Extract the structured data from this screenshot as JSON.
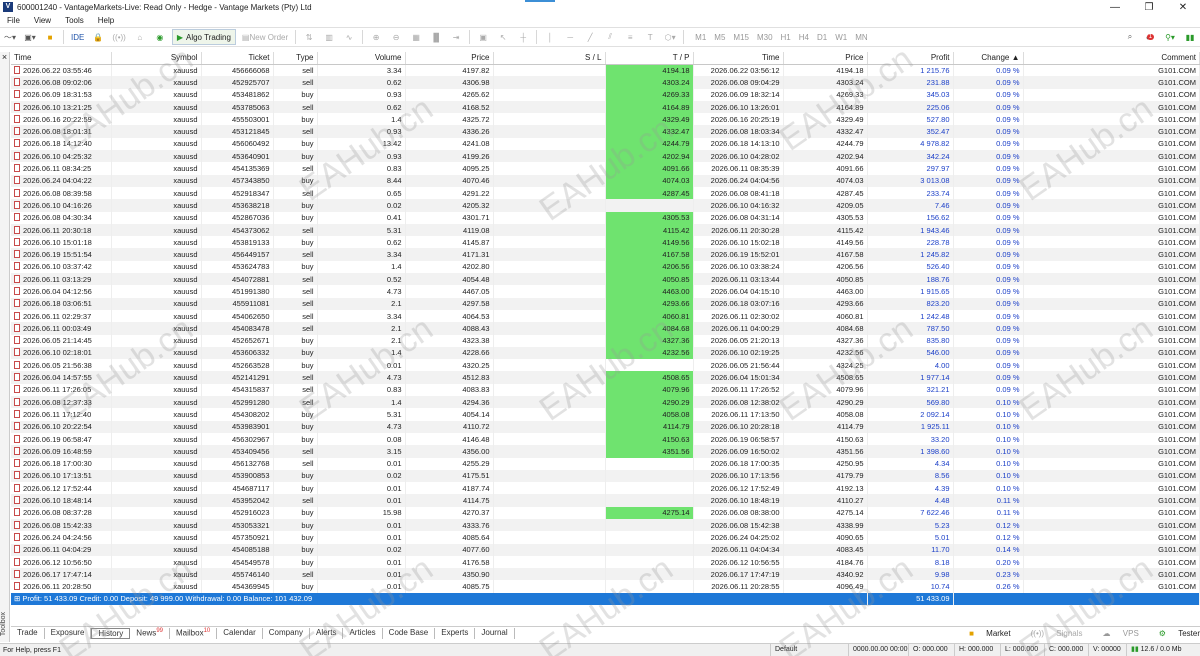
{
  "window": {
    "title": "600001240 - VantageMarkets-Live: Read Only - Hedge - Vantage Markets (Pty) Ltd",
    "app_icon": "V",
    "controls": [
      "—",
      "❐",
      "✕"
    ]
  },
  "menu": [
    "File",
    "View",
    "Tools",
    "Help"
  ],
  "toolbar": {
    "ide_label": "IDE",
    "algo_label": "Algo Trading",
    "new_order_label": "New Order",
    "timeframes": [
      "M1",
      "M5",
      "M15",
      "M30",
      "H1",
      "H4",
      "D1",
      "W1",
      "MN"
    ],
    "notif_count": "1"
  },
  "sidestrip": {
    "close": "×",
    "label": "Toolbox"
  },
  "columns": [
    "Time",
    "Symbol",
    "Ticket",
    "Type",
    "Volume",
    "Price",
    "S / L",
    "T / P",
    "Time",
    "Price",
    "Profit",
    "Change",
    "Comment"
  ],
  "sort_indicator": "▲",
  "rows": [
    {
      "t": "2026.06.22 03:55:46",
      "s": "xauusd",
      "k": "456666068",
      "ty": "sell",
      "v": "3.34",
      "p": "4197.82",
      "sl": "",
      "tp": "4194.18",
      "t2": "2026.06.22 03:56:12",
      "p2": "4194.18",
      "pr": "1 215.76",
      "ch": "0.09 %",
      "c": "G101.COM"
    },
    {
      "t": "2026.06.08 09:02:06",
      "s": "xauusd",
      "k": "452925707",
      "ty": "sell",
      "v": "0.62",
      "p": "4306.98",
      "sl": "",
      "tp": "4303.24",
      "t2": "2026.06.08 09:04:29",
      "p2": "4303.24",
      "pr": "231.88",
      "ch": "0.09 %",
      "c": "G101.COM"
    },
    {
      "t": "2026.06.09 18:31:53",
      "s": "xauusd",
      "k": "453481862",
      "ty": "buy",
      "v": "0.93",
      "p": "4265.62",
      "sl": "",
      "tp": "4269.33",
      "t2": "2026.06.09 18:32:14",
      "p2": "4269.33",
      "pr": "345.03",
      "ch": "0.09 %",
      "c": "G101.COM"
    },
    {
      "t": "2026.06.10 13:21:25",
      "s": "xauusd",
      "k": "453785063",
      "ty": "sell",
      "v": "0.62",
      "p": "4168.52",
      "sl": "",
      "tp": "4164.89",
      "t2": "2026.06.10 13:26:01",
      "p2": "4164.89",
      "pr": "225.06",
      "ch": "0.09 %",
      "c": "G101.COM"
    },
    {
      "t": "2026.06.16 20:22:59",
      "s": "xauusd",
      "k": "455503001",
      "ty": "buy",
      "v": "1.4",
      "p": "4325.72",
      "sl": "",
      "tp": "4329.49",
      "t2": "2026.06.16 20:25:19",
      "p2": "4329.49",
      "pr": "527.80",
      "ch": "0.09 %",
      "c": "G101.COM"
    },
    {
      "t": "2026.06.08 18:01:31",
      "s": "xauusd",
      "k": "453121845",
      "ty": "sell",
      "v": "0.93",
      "p": "4336.26",
      "sl": "",
      "tp": "4332.47",
      "t2": "2026.06.08 18:03:34",
      "p2": "4332.47",
      "pr": "352.47",
      "ch": "0.09 %",
      "c": "G101.COM"
    },
    {
      "t": "2026.06.18 14:12:40",
      "s": "xauusd",
      "k": "456060492",
      "ty": "buy",
      "v": "13.42",
      "p": "4241.08",
      "sl": "",
      "tp": "4244.79",
      "t2": "2026.06.18 14:13:10",
      "p2": "4244.79",
      "pr": "4 978.82",
      "ch": "0.09 %",
      "c": "G101.COM"
    },
    {
      "t": "2026.06.10 04:25:32",
      "s": "xauusd",
      "k": "453640901",
      "ty": "buy",
      "v": "0.93",
      "p": "4199.26",
      "sl": "",
      "tp": "4202.94",
      "t2": "2026.06.10 04:28:02",
      "p2": "4202.94",
      "pr": "342.24",
      "ch": "0.09 %",
      "c": "G101.COM"
    },
    {
      "t": "2026.06.11 08:34:25",
      "s": "xauusd",
      "k": "454135369",
      "ty": "sell",
      "v": "0.83",
      "p": "4095.25",
      "sl": "",
      "tp": "4091.66",
      "t2": "2026.06.11 08:35:39",
      "p2": "4091.66",
      "pr": "297.97",
      "ch": "0.09 %",
      "c": "G101.COM"
    },
    {
      "t": "2026.06.24 04:04:22",
      "s": "xauusd",
      "k": "457343850",
      "ty": "buy",
      "v": "8.44",
      "p": "4070.46",
      "sl": "",
      "tp": "4074.03",
      "t2": "2026.06.24 04:04:56",
      "p2": "4074.03",
      "pr": "3 013.08",
      "ch": "0.09 %",
      "c": "G101.COM"
    },
    {
      "t": "2026.06.08 08:39:58",
      "s": "xauusd",
      "k": "452918347",
      "ty": "sell",
      "v": "0.65",
      "p": "4291.22",
      "sl": "",
      "tp": "4287.45",
      "t2": "2026.06.08 08:41:18",
      "p2": "4287.45",
      "pr": "233.74",
      "ch": "0.09 %",
      "c": "G101.COM"
    },
    {
      "t": "2026.06.10 04:16:26",
      "s": "xauusd",
      "k": "453638218",
      "ty": "buy",
      "v": "0.02",
      "p": "4205.32",
      "sl": "",
      "tp": "",
      "t2": "2026.06.10 04:16:32",
      "p2": "4209.05",
      "pr": "7.46",
      "ch": "0.09 %",
      "c": "G101.COM"
    },
    {
      "t": "2026.06.08 04:30:34",
      "s": "xauusd",
      "k": "452867036",
      "ty": "buy",
      "v": "0.41",
      "p": "4301.71",
      "sl": "",
      "tp": "4305.53",
      "t2": "2026.06.08 04:31:14",
      "p2": "4305.53",
      "pr": "156.62",
      "ch": "0.09 %",
      "c": "G101.COM"
    },
    {
      "t": "2026.06.11 20:30:18",
      "s": "xauusd",
      "k": "454373062",
      "ty": "sell",
      "v": "5.31",
      "p": "4119.08",
      "sl": "",
      "tp": "4115.42",
      "t2": "2026.06.11 20:30:28",
      "p2": "4115.42",
      "pr": "1 943.46",
      "ch": "0.09 %",
      "c": "G101.COM"
    },
    {
      "t": "2026.06.10 15:01:18",
      "s": "xauusd",
      "k": "453819133",
      "ty": "buy",
      "v": "0.62",
      "p": "4145.87",
      "sl": "",
      "tp": "4149.56",
      "t2": "2026.06.10 15:02:18",
      "p2": "4149.56",
      "pr": "228.78",
      "ch": "0.09 %",
      "c": "G101.COM"
    },
    {
      "t": "2026.06.19 15:51:54",
      "s": "xauusd",
      "k": "456449157",
      "ty": "sell",
      "v": "3.34",
      "p": "4171.31",
      "sl": "",
      "tp": "4167.58",
      "t2": "2026.06.19 15:52:01",
      "p2": "4167.58",
      "pr": "1 245.82",
      "ch": "0.09 %",
      "c": "G101.COM"
    },
    {
      "t": "2026.06.10 03:37:42",
      "s": "xauusd",
      "k": "453624783",
      "ty": "buy",
      "v": "1.4",
      "p": "4202.80",
      "sl": "",
      "tp": "4206.56",
      "t2": "2026.06.10 03:38:24",
      "p2": "4206.56",
      "pr": "526.40",
      "ch": "0.09 %",
      "c": "G101.COM"
    },
    {
      "t": "2026.06.11 03:13:29",
      "s": "xauusd",
      "k": "454072881",
      "ty": "sell",
      "v": "0.52",
      "p": "4054.48",
      "sl": "",
      "tp": "4050.85",
      "t2": "2026.06.11 03:13:44",
      "p2": "4050.85",
      "pr": "188.76",
      "ch": "0.09 %",
      "c": "G101.COM"
    },
    {
      "t": "2026.06.04 04:12:56",
      "s": "xauusd",
      "k": "451991380",
      "ty": "sell",
      "v": "4.73",
      "p": "4467.05",
      "sl": "",
      "tp": "4463.00",
      "t2": "2026.06.04 04:15:10",
      "p2": "4463.00",
      "pr": "1 915.65",
      "ch": "0.09 %",
      "c": "G101.COM"
    },
    {
      "t": "2026.06.18 03:06:51",
      "s": "xauusd",
      "k": "455911081",
      "ty": "sell",
      "v": "2.1",
      "p": "4297.58",
      "sl": "",
      "tp": "4293.66",
      "t2": "2026.06.18 03:07:16",
      "p2": "4293.66",
      "pr": "823.20",
      "ch": "0.09 %",
      "c": "G101.COM"
    },
    {
      "t": "2026.06.11 02:29:37",
      "s": "xauusd",
      "k": "454062650",
      "ty": "sell",
      "v": "3.34",
      "p": "4064.53",
      "sl": "",
      "tp": "4060.81",
      "t2": "2026.06.11 02:30:02",
      "p2": "4060.81",
      "pr": "1 242.48",
      "ch": "0.09 %",
      "c": "G101.COM"
    },
    {
      "t": "2026.06.11 00:03:49",
      "s": "xauusd",
      "k": "454083478",
      "ty": "sell",
      "v": "2.1",
      "p": "4088.43",
      "sl": "",
      "tp": "4084.68",
      "t2": "2026.06.11 04:00:29",
      "p2": "4084.68",
      "pr": "787.50",
      "ch": "0.09 %",
      "c": "G101.COM"
    },
    {
      "t": "2026.06.05 21:14:45",
      "s": "xauusd",
      "k": "452652671",
      "ty": "buy",
      "v": "2.1",
      "p": "4323.38",
      "sl": "",
      "tp": "4327.36",
      "t2": "2026.06.05 21:20:13",
      "p2": "4327.36",
      "pr": "835.80",
      "ch": "0.09 %",
      "c": "G101.COM"
    },
    {
      "t": "2026.06.10 02:18:01",
      "s": "xauusd",
      "k": "453606332",
      "ty": "buy",
      "v": "1.4",
      "p": "4228.66",
      "sl": "",
      "tp": "4232.56",
      "t2": "2026.06.10 02:19:25",
      "p2": "4232.56",
      "pr": "546.00",
      "ch": "0.09 %",
      "c": "G101.COM"
    },
    {
      "t": "2026.06.05 21:56:38",
      "s": "xauusd",
      "k": "452663528",
      "ty": "buy",
      "v": "0.01",
      "p": "4320.25",
      "sl": "",
      "tp": "",
      "t2": "2026.06.05 21:56:44",
      "p2": "4324.25",
      "pr": "4.00",
      "ch": "0.09 %",
      "c": "G101.COM"
    },
    {
      "t": "2026.06.04 14:57:55",
      "s": "xauusd",
      "k": "452141291",
      "ty": "sell",
      "v": "4.73",
      "p": "4512.83",
      "sl": "",
      "tp": "4508.65",
      "t2": "2026.06.04 15:01:34",
      "p2": "4508.65",
      "pr": "1 977.14",
      "ch": "0.09 %",
      "c": "G101.COM"
    },
    {
      "t": "2026.06.11 17:26:05",
      "s": "xauusd",
      "k": "454315837",
      "ty": "sell",
      "v": "0.83",
      "p": "4083.83",
      "sl": "",
      "tp": "4079.96",
      "t2": "2026.06.11 17:26:52",
      "p2": "4079.96",
      "pr": "321.21",
      "ch": "0.09 %",
      "c": "G101.COM"
    },
    {
      "t": "2026.06.08 12:37:33",
      "s": "xauusd",
      "k": "452991280",
      "ty": "sell",
      "v": "1.4",
      "p": "4294.36",
      "sl": "",
      "tp": "4290.29",
      "t2": "2026.06.08 12:38:02",
      "p2": "4290.29",
      "pr": "569.80",
      "ch": "0.10 %",
      "c": "G101.COM"
    },
    {
      "t": "2026.06.11 17:12:40",
      "s": "xauusd",
      "k": "454308202",
      "ty": "buy",
      "v": "5.31",
      "p": "4054.14",
      "sl": "",
      "tp": "4058.08",
      "t2": "2026.06.11 17:13:50",
      "p2": "4058.08",
      "pr": "2 092.14",
      "ch": "0.10 %",
      "c": "G101.COM"
    },
    {
      "t": "2026.06.10 20:22:54",
      "s": "xauusd",
      "k": "453983901",
      "ty": "buy",
      "v": "4.73",
      "p": "4110.72",
      "sl": "",
      "tp": "4114.79",
      "t2": "2026.06.10 20:28:18",
      "p2": "4114.79",
      "pr": "1 925.11",
      "ch": "0.10 %",
      "c": "G101.COM"
    },
    {
      "t": "2026.06.19 06:58:47",
      "s": "xauusd",
      "k": "456302967",
      "ty": "buy",
      "v": "0.08",
      "p": "4146.48",
      "sl": "",
      "tp": "4150.63",
      "t2": "2026.06.19 06:58:57",
      "p2": "4150.63",
      "pr": "33.20",
      "ch": "0.10 %",
      "c": "G101.COM"
    },
    {
      "t": "2026.06.09 16:48:59",
      "s": "xauusd",
      "k": "453409456",
      "ty": "sell",
      "v": "3.15",
      "p": "4356.00",
      "sl": "",
      "tp": "4351.56",
      "t2": "2026.06.09 16:50:02",
      "p2": "4351.56",
      "pr": "1 398.60",
      "ch": "0.10 %",
      "c": "G101.COM"
    },
    {
      "t": "2026.06.18 17:00:30",
      "s": "xauusd",
      "k": "456132768",
      "ty": "sell",
      "v": "0.01",
      "p": "4255.29",
      "sl": "",
      "tp": "",
      "t2": "2026.06.18 17:00:35",
      "p2": "4250.95",
      "pr": "4.34",
      "ch": "0.10 %",
      "c": "G101.COM"
    },
    {
      "t": "2026.06.10 17:13:51",
      "s": "xauusd",
      "k": "453900853",
      "ty": "buy",
      "v": "0.02",
      "p": "4175.51",
      "sl": "",
      "tp": "",
      "t2": "2026.06.10 17:13:56",
      "p2": "4179.79",
      "pr": "8.56",
      "ch": "0.10 %",
      "c": "G101.COM"
    },
    {
      "t": "2026.06.12 17:52:44",
      "s": "xauusd",
      "k": "454687117",
      "ty": "buy",
      "v": "0.01",
      "p": "4187.74",
      "sl": "",
      "tp": "",
      "t2": "2026.06.12 17:52:49",
      "p2": "4192.13",
      "pr": "4.39",
      "ch": "0.10 %",
      "c": "G101.COM"
    },
    {
      "t": "2026.06.10 18:48:14",
      "s": "xauusd",
      "k": "453952042",
      "ty": "sell",
      "v": "0.01",
      "p": "4114.75",
      "sl": "",
      "tp": "",
      "t2": "2026.06.10 18:48:19",
      "p2": "4110.27",
      "pr": "4.48",
      "ch": "0.11 %",
      "c": "G101.COM"
    },
    {
      "t": "2026.06.08 08:37:28",
      "s": "xauusd",
      "k": "452916023",
      "ty": "buy",
      "v": "15.98",
      "p": "4270.37",
      "sl": "",
      "tp": "4275.14",
      "t2": "2026.06.08 08:38:00",
      "p2": "4275.14",
      "pr": "7 622.46",
      "ch": "0.11 %",
      "c": "G101.COM"
    },
    {
      "t": "2026.06.08 15:42:33",
      "s": "xauusd",
      "k": "453053321",
      "ty": "buy",
      "v": "0.01",
      "p": "4333.76",
      "sl": "",
      "tp": "",
      "t2": "2026.06.08 15:42:38",
      "p2": "4338.99",
      "pr": "5.23",
      "ch": "0.12 %",
      "c": "G101.COM"
    },
    {
      "t": "2026.06.24 04:24:56",
      "s": "xauusd",
      "k": "457350921",
      "ty": "buy",
      "v": "0.01",
      "p": "4085.64",
      "sl": "",
      "tp": "",
      "t2": "2026.06.24 04:25:02",
      "p2": "4090.65",
      "pr": "5.01",
      "ch": "0.12 %",
      "c": "G101.COM"
    },
    {
      "t": "2026.06.11 04:04:29",
      "s": "xauusd",
      "k": "454085188",
      "ty": "buy",
      "v": "0.02",
      "p": "4077.60",
      "sl": "",
      "tp": "",
      "t2": "2026.06.11 04:04:34",
      "p2": "4083.45",
      "pr": "11.70",
      "ch": "0.14 %",
      "c": "G101.COM"
    },
    {
      "t": "2026.06.12 10:56:50",
      "s": "xauusd",
      "k": "454549578",
      "ty": "buy",
      "v": "0.01",
      "p": "4176.58",
      "sl": "",
      "tp": "",
      "t2": "2026.06.12 10:56:55",
      "p2": "4184.76",
      "pr": "8.18",
      "ch": "0.20 %",
      "c": "G101.COM"
    },
    {
      "t": "2026.06.17 17:47:14",
      "s": "xauusd",
      "k": "455746140",
      "ty": "sell",
      "v": "0.01",
      "p": "4350.90",
      "sl": "",
      "tp": "",
      "t2": "2026.06.17 17:47:19",
      "p2": "4340.92",
      "pr": "9.98",
      "ch": "0.23 %",
      "c": "G101.COM"
    },
    {
      "t": "2026.06.11 20:28:50",
      "s": "xauusd",
      "k": "454369945",
      "ty": "buy",
      "v": "0.01",
      "p": "4085.75",
      "sl": "",
      "tp": "",
      "t2": "2026.06.11 20:28:55",
      "p2": "4096.49",
      "pr": "10.74",
      "ch": "0.26 %",
      "c": "G101.COM"
    }
  ],
  "summary": {
    "text": "Profit: 51 433.09  Credit: 0.00  Deposit: 49 999.00  Withdrawal: 0.00  Balance: 101 432.09",
    "profit_total": "51 433.09"
  },
  "bottom_tabs": [
    {
      "label": "Trade"
    },
    {
      "label": "Exposure"
    },
    {
      "label": "History",
      "active": true
    },
    {
      "label": "News",
      "badge": "99"
    },
    {
      "label": "Mailbox",
      "badge": "10"
    },
    {
      "label": "Calendar"
    },
    {
      "label": "Company"
    },
    {
      "label": "Alerts"
    },
    {
      "label": "Articles"
    },
    {
      "label": "Code Base"
    },
    {
      "label": "Experts"
    },
    {
      "label": "Journal"
    }
  ],
  "bottom_right": [
    "Market",
    "Signals",
    "VPS",
    "Tester"
  ],
  "statusbar": {
    "help": "For Help, press F1",
    "profile": "Default",
    "datetime": "0000.00.00 00:00",
    "o": "O: 000.000",
    "h": "H: 000.000",
    "l": "L: 000.000",
    "c": "C: 000.000",
    "v": "V: 00000",
    "traffic": "12.6 / 0.0 Mb"
  },
  "watermark": "EAHub.cn",
  "colors": {
    "tp_highlight": "#6fe36f",
    "profit_text": "#1a3ec8",
    "summary_bg": "#1e78d7"
  }
}
